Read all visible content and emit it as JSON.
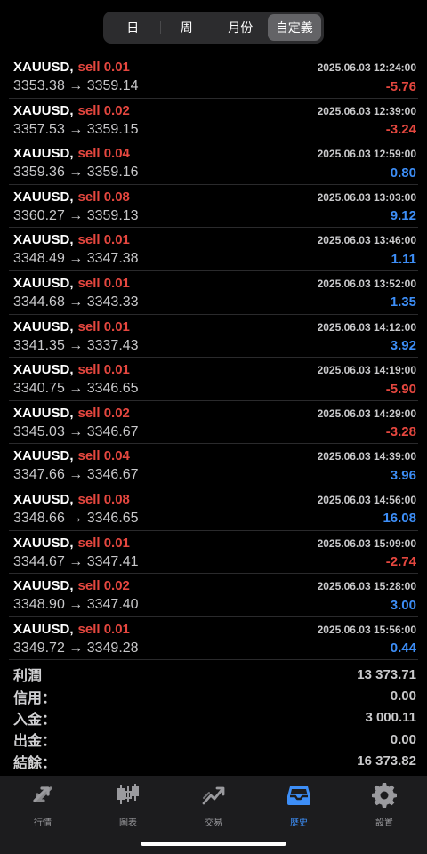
{
  "period_tabs": [
    {
      "label": "日",
      "active": false
    },
    {
      "label": "周",
      "active": false
    },
    {
      "label": "月份",
      "active": false
    },
    {
      "label": "自定義",
      "active": true
    }
  ],
  "trades": [
    {
      "symbol": "XAUUSD,",
      "side": "sell 0.01",
      "time": "2025.06.03 12:24:00",
      "prices": "3353.38 → 3359.14",
      "profit": "-5.76",
      "sign": "neg"
    },
    {
      "symbol": "XAUUSD,",
      "side": "sell 0.02",
      "time": "2025.06.03 12:39:00",
      "prices": "3357.53 → 3359.15",
      "profit": "-3.24",
      "sign": "neg"
    },
    {
      "symbol": "XAUUSD,",
      "side": "sell 0.04",
      "time": "2025.06.03 12:59:00",
      "prices": "3359.36 → 3359.16",
      "profit": "0.80",
      "sign": "pos"
    },
    {
      "symbol": "XAUUSD,",
      "side": "sell 0.08",
      "time": "2025.06.03 13:03:00",
      "prices": "3360.27 → 3359.13",
      "profit": "9.12",
      "sign": "pos"
    },
    {
      "symbol": "XAUUSD,",
      "side": "sell 0.01",
      "time": "2025.06.03 13:46:00",
      "prices": "3348.49 → 3347.38",
      "profit": "1.11",
      "sign": "pos"
    },
    {
      "symbol": "XAUUSD,",
      "side": "sell 0.01",
      "time": "2025.06.03 13:52:00",
      "prices": "3344.68 → 3343.33",
      "profit": "1.35",
      "sign": "pos"
    },
    {
      "symbol": "XAUUSD,",
      "side": "sell 0.01",
      "time": "2025.06.03 14:12:00",
      "prices": "3341.35 → 3337.43",
      "profit": "3.92",
      "sign": "pos"
    },
    {
      "symbol": "XAUUSD,",
      "side": "sell 0.01",
      "time": "2025.06.03 14:19:00",
      "prices": "3340.75 → 3346.65",
      "profit": "-5.90",
      "sign": "neg"
    },
    {
      "symbol": "XAUUSD,",
      "side": "sell 0.02",
      "time": "2025.06.03 14:29:00",
      "prices": "3345.03 → 3346.67",
      "profit": "-3.28",
      "sign": "neg"
    },
    {
      "symbol": "XAUUSD,",
      "side": "sell 0.04",
      "time": "2025.06.03 14:39:00",
      "prices": "3347.66 → 3346.67",
      "profit": "3.96",
      "sign": "pos"
    },
    {
      "symbol": "XAUUSD,",
      "side": "sell 0.08",
      "time": "2025.06.03 14:56:00",
      "prices": "3348.66 → 3346.65",
      "profit": "16.08",
      "sign": "pos"
    },
    {
      "symbol": "XAUUSD,",
      "side": "sell 0.01",
      "time": "2025.06.03 15:09:00",
      "prices": "3344.67 → 3347.41",
      "profit": "-2.74",
      "sign": "neg"
    },
    {
      "symbol": "XAUUSD,",
      "side": "sell 0.02",
      "time": "2025.06.03 15:28:00",
      "prices": "3348.90 → 3347.40",
      "profit": "3.00",
      "sign": "pos"
    },
    {
      "symbol": "XAUUSD,",
      "side": "sell 0.01",
      "time": "2025.06.03 15:56:00",
      "prices": "3349.72 → 3349.28",
      "profit": "0.44",
      "sign": "pos"
    }
  ],
  "summary": [
    {
      "label": "利潤",
      "value": "13 373.71"
    },
    {
      "label": "信用：",
      "value": "0.00"
    },
    {
      "label": "入金：",
      "value": "3 000.11"
    },
    {
      "label": "出金：",
      "value": "0.00"
    },
    {
      "label": "結餘：",
      "value": "16 373.82"
    }
  ],
  "tabbar": [
    {
      "label": "行情",
      "icon": "quotes-arrows-icon",
      "active": false
    },
    {
      "label": "圖表",
      "icon": "candlestick-chart-icon",
      "active": false
    },
    {
      "label": "交易",
      "icon": "trade-trend-icon",
      "active": false
    },
    {
      "label": "歷史",
      "icon": "history-inbox-icon",
      "active": true
    },
    {
      "label": "設置",
      "icon": "gear-icon",
      "active": false
    }
  ],
  "colors": {
    "loss": "#e5473f",
    "profit": "#3d8ef7",
    "tab_active": "#3d8ef7",
    "background": "#000000"
  }
}
